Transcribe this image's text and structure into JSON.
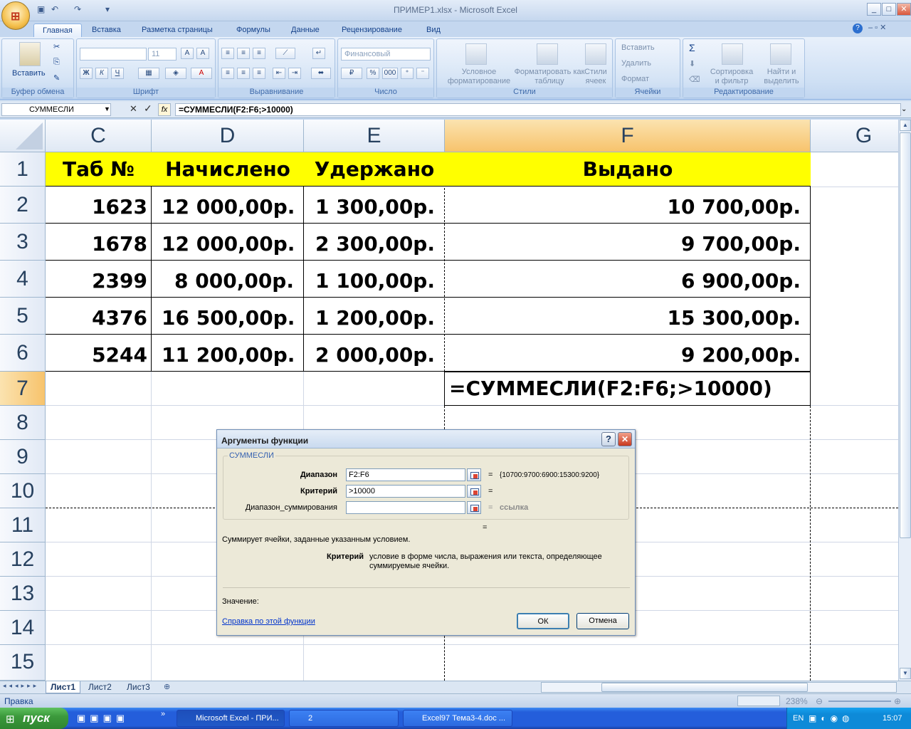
{
  "window": {
    "title": "ПРИМЕР1.xlsx - Microsoft Excel"
  },
  "ribbon": {
    "tabs": [
      "Главная",
      "Вставка",
      "Разметка страницы",
      "Формулы",
      "Данные",
      "Рецензирование",
      "Вид"
    ],
    "groups": {
      "clipboard": {
        "label": "Буфер обмена",
        "paste": "Вставить"
      },
      "font": {
        "label": "Шрифт",
        "size": "11",
        "bold": "Ж",
        "italic": "К",
        "underline": "Ч"
      },
      "alignment": {
        "label": "Выравнивание"
      },
      "number": {
        "label": "Число",
        "format": "Финансовый",
        "percent": "%",
        "thousands": "000"
      },
      "styles": {
        "label": "Стили",
        "conditional": "Условное форматирование",
        "as_table": "Форматировать как таблицу",
        "cell_styles": "Стили ячеек"
      },
      "cells": {
        "label": "Ячейки",
        "insert": "Вставить",
        "delete": "Удалить",
        "format": "Формат"
      },
      "editing": {
        "label": "Редактирование",
        "sort": "Сортировка и фильтр",
        "find": "Найти и выделить"
      }
    }
  },
  "formula_bar": {
    "name_box": "СУММЕСЛИ",
    "formula": "=СУММЕСЛИ(F2:F6;>10000)"
  },
  "sheet": {
    "columns": [
      "C",
      "D",
      "E",
      "F",
      "G"
    ],
    "rows": [
      "1",
      "2",
      "3",
      "4",
      "5",
      "6",
      "7",
      "8",
      "9",
      "10",
      "11",
      "12",
      "13",
      "14",
      "15"
    ],
    "header": [
      "Таб №",
      "Начислено",
      "Удержано",
      "Выдано"
    ],
    "data": [
      [
        "1623",
        "12 000,00р.",
        "1 300,00р.",
        "10 700,00р."
      ],
      [
        "1678",
        "12 000,00р.",
        "2 300,00р.",
        "9 700,00р."
      ],
      [
        "2399",
        "8 000,00р.",
        "1 100,00р.",
        "6 900,00р."
      ],
      [
        "4376",
        "16 500,00р.",
        "1 200,00р.",
        "15 300,00р."
      ],
      [
        "5244",
        "11 200,00р.",
        "2 000,00р.",
        "9 200,00р."
      ]
    ],
    "f7": "=СУММЕСЛИ(F2:F6;>10000)",
    "tabs": [
      "Лист1",
      "Лист2",
      "Лист3"
    ]
  },
  "status": {
    "mode": "Правка",
    "zoom": "238%"
  },
  "dialog": {
    "title": "Аргументы функции",
    "function": "СУММЕСЛИ",
    "args": [
      {
        "label": "Диапазон",
        "value": "F2:F6",
        "eq": "=",
        "result": "{10700:9700:6900:15300:9200}"
      },
      {
        "label": "Критерий",
        "value": ">10000",
        "eq": "=",
        "result": ""
      },
      {
        "label": "Диапазон_суммирования",
        "value": "",
        "eq": "=",
        "result": "ссылка"
      }
    ],
    "eq_total": "=",
    "description": "Суммирует ячейки, заданные указанным условием.",
    "arg_help_name": "Критерий",
    "arg_help_text": "условие в форме числа, выражения или текста, определяющее суммируемые ячейки.",
    "value_label": "Значение:",
    "help_link": "Справка по этой функции",
    "ok": "ОК",
    "cancel": "Отмена",
    "help_btn": "?",
    "close_btn": "✕"
  },
  "taskbar": {
    "start": "пуск",
    "tasks": [
      "Microsoft Excel - ПРИ...",
      "2",
      "Excel97 Тема3-4.doc ..."
    ],
    "lang": "EN",
    "clock": "15:07"
  },
  "colors": {
    "header_fill": "#ffff00",
    "selected_header": "#f7c36c",
    "ribbon_bg": "#cfe0f4",
    "taskbar": "#245edb"
  }
}
